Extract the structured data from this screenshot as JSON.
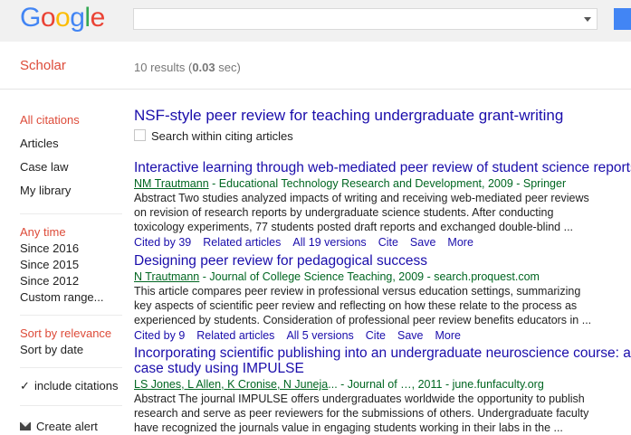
{
  "logo": {
    "letters": [
      "G",
      "o",
      "o",
      "g",
      "l",
      "e"
    ],
    "colors": [
      "#4285f4",
      "#ea4335",
      "#fbbc05",
      "#4285f4",
      "#34a853",
      "#ea4335"
    ]
  },
  "search": {
    "value": "",
    "placeholder": ""
  },
  "header": {
    "scholar_label": "Scholar",
    "results_prefix": "10 results (",
    "results_time": "0.03",
    "results_suffix": " sec)"
  },
  "sidebar": {
    "all_citations": "All citations",
    "articles": "Articles",
    "case_law": "Case law",
    "my_library": "My library",
    "any_time": "Any time",
    "since_2016": "Since 2016",
    "since_2015": "Since 2015",
    "since_2012": "Since 2012",
    "custom_range": "Custom range...",
    "sort_relevance": "Sort by relevance",
    "sort_date": "Sort by date",
    "include_citations": "include citations",
    "create_alert": "Create alert"
  },
  "main": {
    "title": "NSF-style peer review for teaching undergraduate grant-writing",
    "search_within": "Search within citing articles"
  },
  "results": [
    {
      "title": "Interactive learning through web-mediated peer review of student science reports",
      "author": "NM Trautmann",
      "source": " - Educational Technology Research and Development, 2009 - Springer",
      "snippet": [
        "Abstract Two studies analyzed impacts of writing and receiving web-mediated peer reviews",
        "on revision of research reports by undergraduate science students. After conducting",
        "toxicology experiments, 77 students posted draft reports and exchanged double-blind ..."
      ],
      "cited_by": "Cited by 39",
      "related": "Related articles",
      "versions": "All 19 versions",
      "cite": "Cite",
      "save": "Save",
      "more": "More"
    },
    {
      "title": "Designing peer review for pedagogical success",
      "author": "N Trautmann",
      "source": " - Journal of College Science Teaching, 2009 - search.proquest.com",
      "snippet": [
        "This article compares peer review in professional versus education settings, summarizing",
        "key aspects of scientific peer review and reflecting on how these relate to the process as",
        "experienced by students. Consideration of professional peer review benefits educators in ..."
      ],
      "cited_by": "Cited by 9",
      "related": "Related articles",
      "versions": "All 5 versions",
      "cite": "Cite",
      "save": "Save",
      "more": "More"
    },
    {
      "title_line1": "Incorporating scientific publishing into an undergraduate neuroscience course: a",
      "title_line2": "case study using IMPULSE",
      "author": "LS Jones, L Allen, K Cronise, N Juneja",
      "source": "... - Journal of …, 2011 - june.funfaculty.org",
      "snippet": [
        "Abstract The journal IMPULSE offers undergraduates worldwide the opportunity to publish",
        "research and serve as peer reviewers for the submissions of others. Undergraduate faculty",
        "have recognized the journals value in engaging students working in their labs in the ..."
      ]
    }
  ]
}
